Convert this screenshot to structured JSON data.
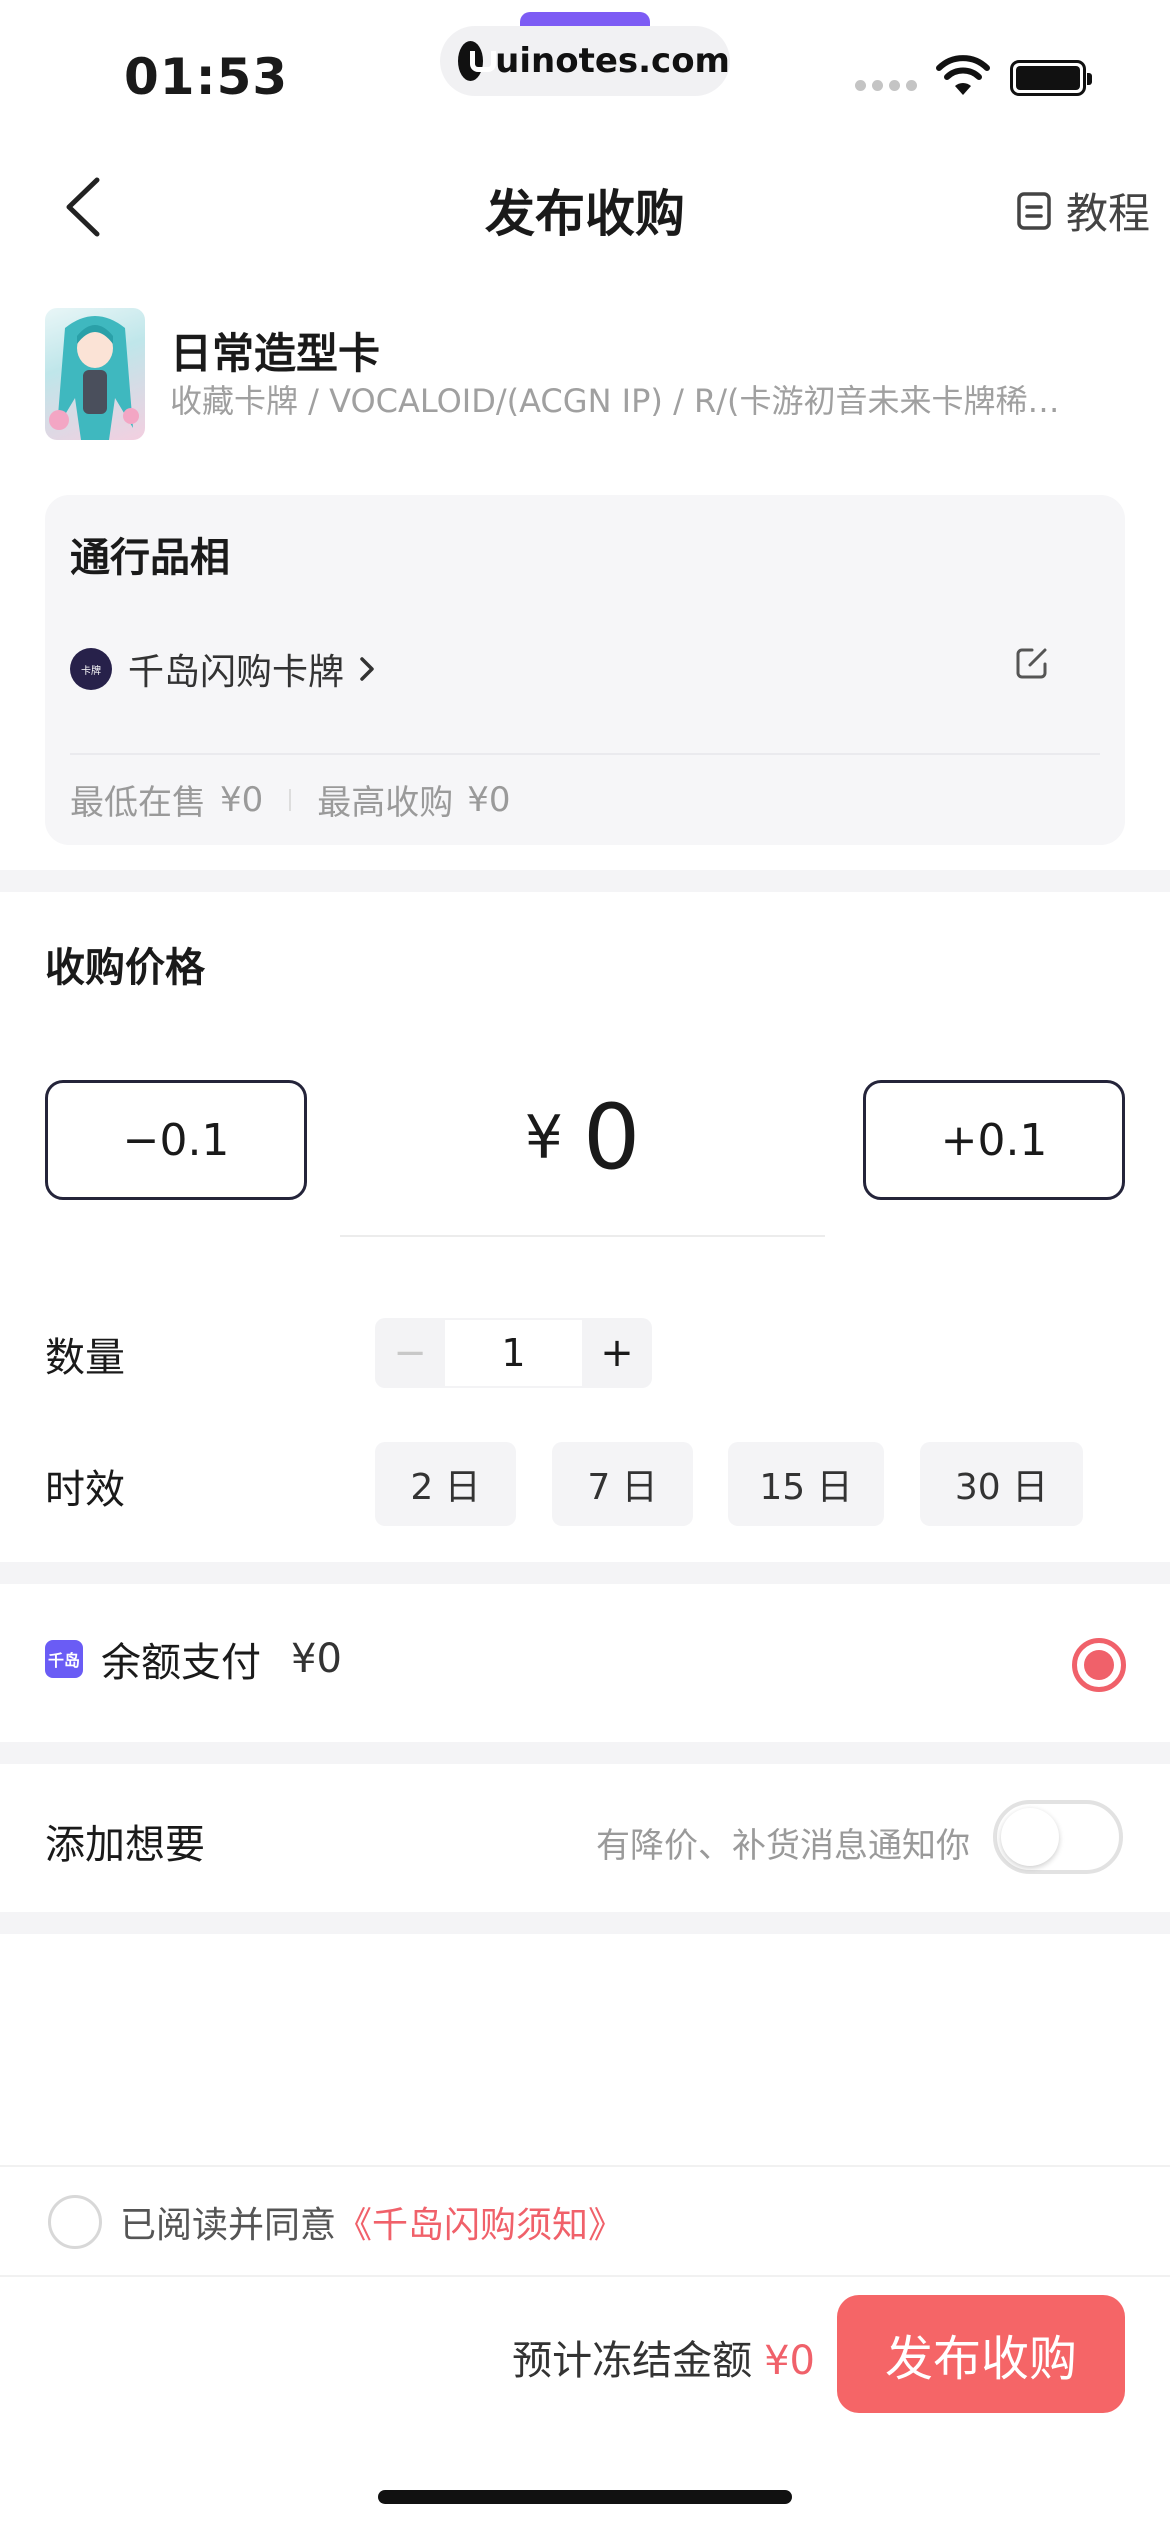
{
  "status_bar": {
    "time": "01:53",
    "url": "uinotes.com"
  },
  "nav": {
    "title": "发布收购",
    "tutorial_label": "教程"
  },
  "product": {
    "name": "日常造型卡",
    "path": "收藏卡牌 / VOCALOID/(ACGN IP) / R/(卡游初音未来卡牌稀…"
  },
  "condition": {
    "title": "通行品相",
    "shop_name": "千岛闪购卡牌",
    "lowest_sale_label": "最低在售",
    "lowest_sale_value": "¥0",
    "highest_buy_label": "最高收购",
    "highest_buy_value": "¥0"
  },
  "price": {
    "title": "收购价格",
    "minus_label": "−0.1",
    "plus_label": "+0.1",
    "currency": "¥",
    "value": "0"
  },
  "quantity": {
    "label": "数量",
    "minus": "−",
    "plus": "+",
    "value": "1"
  },
  "validity": {
    "label": "时效",
    "options": [
      "2 日",
      "7 日",
      "15 日",
      "30 日"
    ]
  },
  "payment": {
    "label": "余额支付",
    "amount": "¥0",
    "selected": true
  },
  "wishlist": {
    "label": "添加想要",
    "hint": "有降价、补货消息通知你",
    "enabled": false
  },
  "agreement": {
    "prefix": "已阅读并同意",
    "link": "《千岛闪购须知》",
    "checked": false
  },
  "footer": {
    "freeze_label": "预计冻结金额",
    "freeze_value": "¥0",
    "publish_label": "发布收购"
  },
  "colors": {
    "accent": "#f56567",
    "brand_purple": "#6a5cf5",
    "dark_border": "#24243a"
  }
}
